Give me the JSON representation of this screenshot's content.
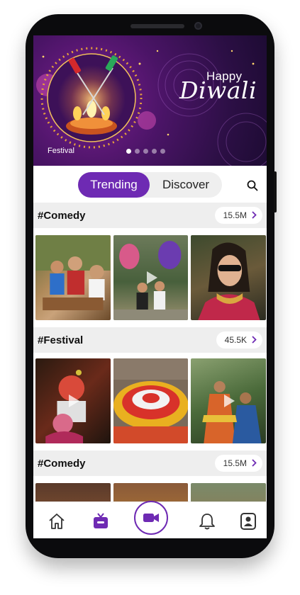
{
  "banner": {
    "greeting_line1": "Happy",
    "greeting_line2": "Diwali",
    "category_label": "Festival",
    "slide_dots": 5,
    "active_slide": 1
  },
  "tabs": {
    "items": [
      {
        "label": "Trending",
        "active": true
      },
      {
        "label": "Discover",
        "active": false
      }
    ]
  },
  "sections": [
    {
      "title": "#Comedy",
      "count": "15.5M"
    },
    {
      "title": "#Festival",
      "count": "45.5K"
    },
    {
      "title": "#Comedy",
      "count": "15.5M"
    }
  ],
  "icons": {
    "search": "search-icon",
    "home": "home-icon",
    "tv": "tv-icon",
    "record": "video-camera-icon",
    "notifications": "bell-icon",
    "profile": "profile-icon",
    "chevron": "chevron-right-icon",
    "play": "play-icon"
  },
  "colors": {
    "accent": "#6e2ab3",
    "banner_bg": "#2c0f45",
    "section_bg": "#eeeeee"
  }
}
